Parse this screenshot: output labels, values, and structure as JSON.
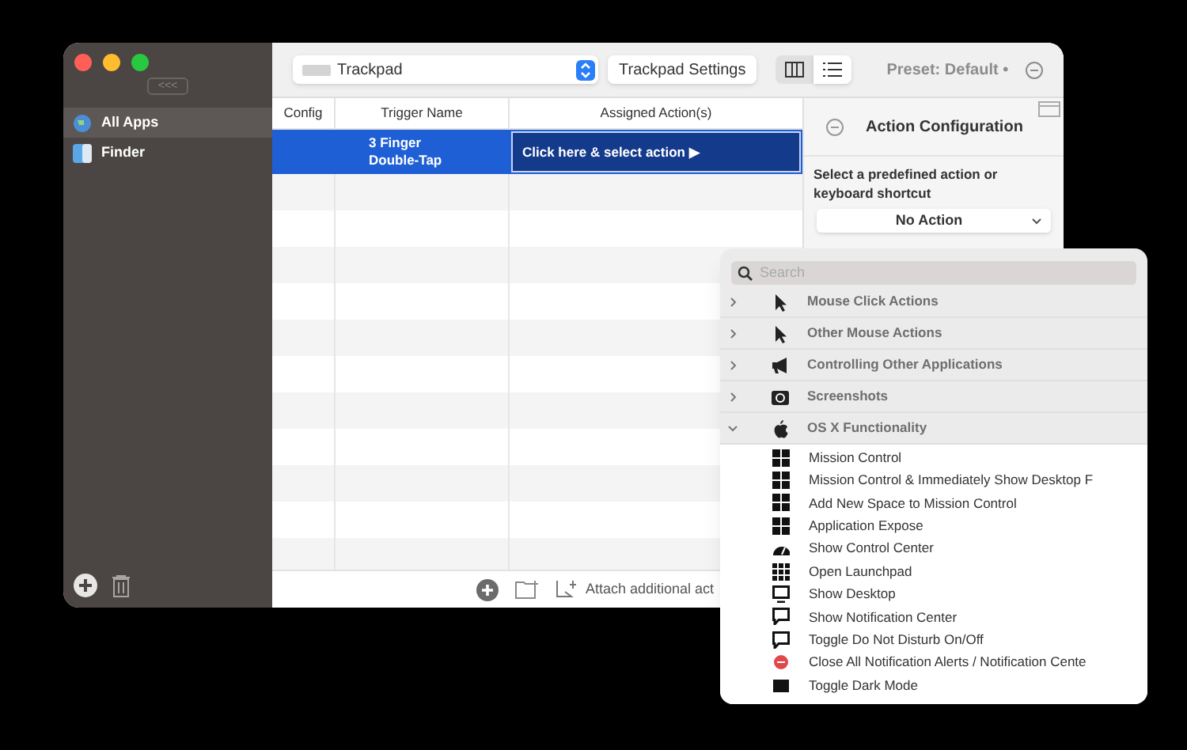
{
  "sidebar": {
    "collapse_label": "<<<",
    "items": [
      {
        "label": "All Apps",
        "selected": true,
        "kind": "globe"
      },
      {
        "label": "Finder",
        "selected": false,
        "kind": "finder"
      }
    ]
  },
  "toolbar": {
    "device": "Trackpad",
    "settings_button": "Trackpad Settings",
    "views": [
      {
        "kind": "columns",
        "selected": false
      },
      {
        "kind": "list",
        "selected": true
      }
    ],
    "preset": "Preset: Default •"
  },
  "table": {
    "columns": [
      "Config",
      "Trigger Name",
      "Assigned Action(s)"
    ],
    "rows": [
      {
        "trigger": "3 Finger Double-Tap",
        "action": "Click here & select action ▶",
        "selected": true
      }
    ]
  },
  "bottom_bar": {
    "attach_label": "Attach additional act"
  },
  "action_panel": {
    "title": "Action Configuration",
    "prompt": "Select a predefined action or keyboard shortcut",
    "select_value": "No Action"
  },
  "popup": {
    "search_placeholder": "Search",
    "categories": [
      {
        "label": "Mouse Click Actions",
        "expanded": false,
        "kind": "pointer"
      },
      {
        "label": "Other Mouse Actions",
        "expanded": false,
        "kind": "pointer"
      },
      {
        "label": "Controlling Other Applications",
        "expanded": false,
        "kind": "megaphone"
      },
      {
        "label": "Screenshots",
        "expanded": false,
        "kind": "camera"
      },
      {
        "label": "OS X Functionality",
        "expanded": true,
        "kind": "apple"
      }
    ],
    "items": [
      {
        "label": "Mission Control",
        "kind": "grid"
      },
      {
        "label": "Mission Control & Immediately Show Desktop F",
        "kind": "grid"
      },
      {
        "label": "Add New Space to Mission Control",
        "kind": "grid"
      },
      {
        "label": "Application Expose",
        "kind": "grid"
      },
      {
        "label": "Show Control Center",
        "kind": "gauge"
      },
      {
        "label": "Open Launchpad",
        "kind": "dots"
      },
      {
        "label": "Show Desktop",
        "kind": "monitor"
      },
      {
        "label": "Show Notification Center",
        "kind": "bubble"
      },
      {
        "label": "Toggle Do Not Disturb On/Off",
        "kind": "bubble"
      },
      {
        "label": "Close All Notification Alerts / Notification Cente",
        "kind": "redcircle"
      },
      {
        "label": "Toggle Dark Mode",
        "kind": "square"
      }
    ]
  }
}
